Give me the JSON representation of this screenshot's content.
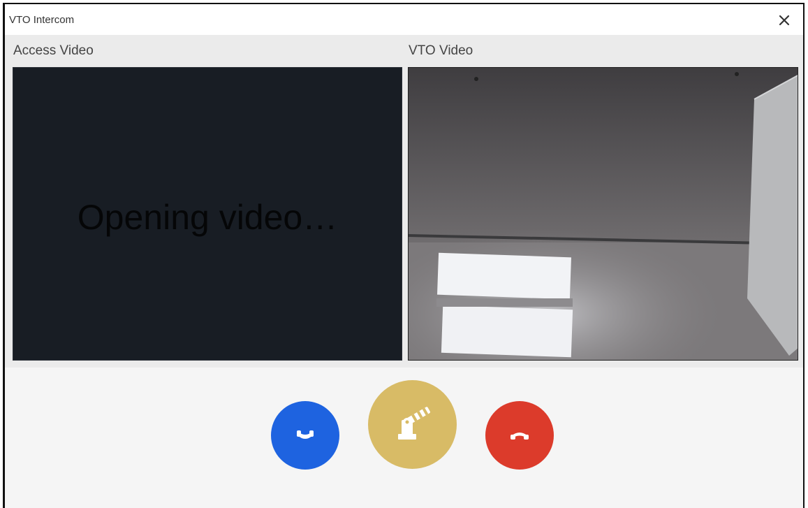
{
  "window": {
    "title": "VTO Intercom",
    "close_icon": "close-icon"
  },
  "videos": {
    "access": {
      "label": "Access Video",
      "status": "Opening video…"
    },
    "vto": {
      "label": "VTO Video"
    }
  },
  "controls": {
    "answer": {
      "icon": "phone-answer-icon",
      "color": "#1e63e0"
    },
    "open_gate": {
      "icon": "barrier-gate-icon",
      "color": "#d8bb66"
    },
    "hangup": {
      "icon": "phone-hangup-icon",
      "color": "#dc3b2b"
    }
  }
}
